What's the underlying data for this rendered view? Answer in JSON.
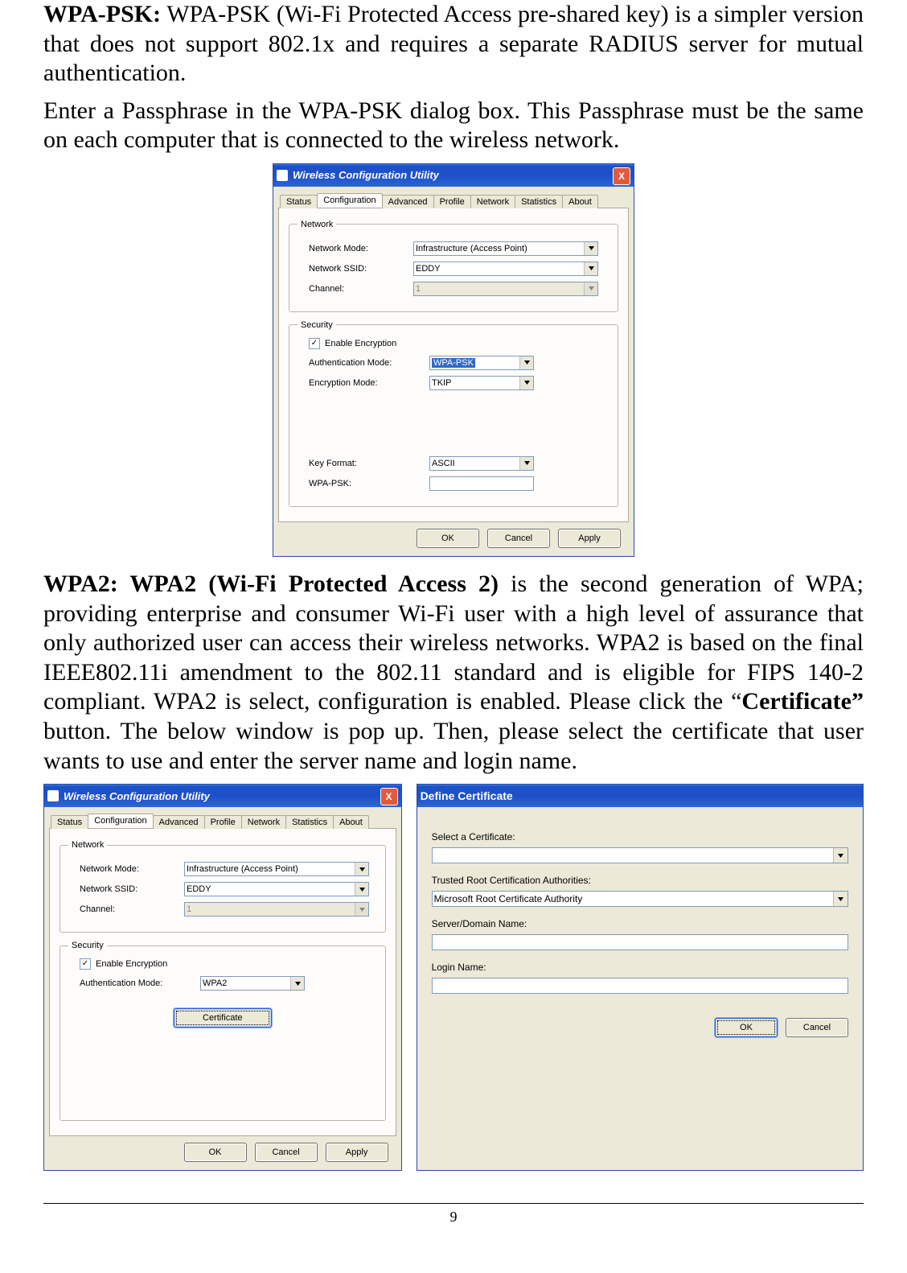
{
  "doc": {
    "p1_lead": "WPA-PSK:",
    "p1_rest": " WPA-PSK (Wi-Fi Protected Access pre-shared key) is a simpler version that does not support 802.1x and requires a separate RADIUS server for mutual authentication.",
    "p2": "Enter a Passphrase in the WPA-PSK dialog box. This Passphrase must be the same on each computer that is connected to the wireless network.",
    "p3_lead": "WPA2: WPA2 (Wi-Fi Protected Access 2)",
    "p3_mid1": " is the second generation of WPA; providing enterprise and consumer Wi-Fi user with a high level of assurance that only authorized user can access their wireless networks. WPA2 is based on the final IEEE802.11i amendment to the 802.11 standard and is eligible for FIPS 140-2 compliant. WPA2 is select, configuration is enabled.  Please click the “",
    "p3_bold_cert": "Certificate”",
    "p3_mid2": " button. The below window is pop up. Then, please select the certificate that user wants to use and enter the server name and login name.",
    "page_number": "9"
  },
  "win": {
    "title": "Wireless Configuration Utility",
    "close": "X",
    "tabs": [
      "Status",
      "Configuration",
      "Advanced",
      "Profile",
      "Network",
      "Statistics",
      "About"
    ],
    "group_network": "Network",
    "group_security": "Security",
    "lbl_network_mode": "Network Mode:",
    "lbl_network_ssid": "Network SSID:",
    "lbl_channel": "Channel:",
    "lbl_enable_enc": "Enable Encryption",
    "lbl_auth_mode": "Authentication Mode:",
    "lbl_enc_mode": "Encryption Mode:",
    "lbl_key_format": "Key Format:",
    "lbl_wpa_psk": "WPA-PSK:",
    "val_network_mode": "Infrastructure (Access Point)",
    "val_ssid": "EDDY",
    "val_channel": "1",
    "val_auth_wpapsk": "WPA-PSK",
    "val_enc_tkip": "TKIP",
    "val_key_format": "ASCII",
    "val_psk": "",
    "val_auth_wpa2": "WPA2",
    "btn_certificate": "Certificate",
    "btn_ok": "OK",
    "btn_cancel": "Cancel",
    "btn_apply": "Apply",
    "check_mark": "✓"
  },
  "dc": {
    "title": "Define Certificate",
    "lbl_select_cert": "Select a Certificate:",
    "lbl_trusted": "Trusted Root Certification Authorities:",
    "val_trusted": "Microsoft Root Certificate Authority",
    "lbl_server": "Server/Domain Name:",
    "lbl_login": "Login Name:",
    "btn_ok": "OK",
    "btn_cancel": "Cancel"
  }
}
